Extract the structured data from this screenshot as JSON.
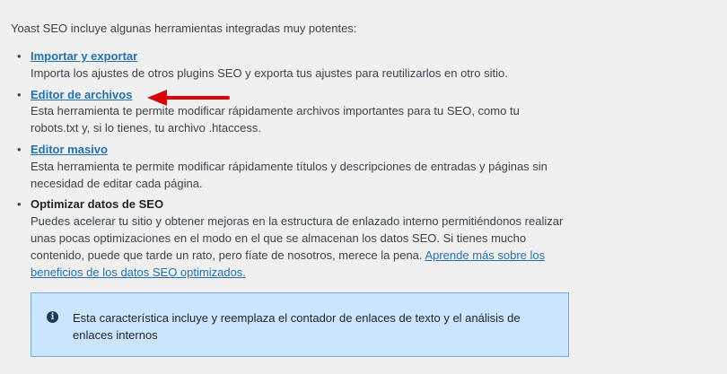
{
  "intro": "Yoast SEO incluye algunas herramientas integradas muy potentes:",
  "tools": [
    {
      "title": "Importar y exportar",
      "description": "Importa los ajustes de otros plugins SEO y exporta tus ajustes para reutilizarlos en otro sitio."
    },
    {
      "title": "Editor de archivos",
      "description": "Esta herramienta te permite modificar rápidamente archivos importantes para tu SEO, como tu robots.txt y, si lo tienes, tu archivo .htaccess."
    },
    {
      "title": "Editor masivo",
      "description": "Esta herramienta te permite modificar rápidamente títulos y descripciones de entradas y páginas sin necesidad de editar cada página."
    },
    {
      "title": "Optimizar datos de SEO",
      "description": "Puedes acelerar tu sitio y obtener mejoras en la estructura de enlazado interno permitiéndonos realizar unas pocas optimizaciones en el modo en el que se almacenan los datos SEO. Si tienes mucho contenido, puede que tarde un rato, pero fíate de nosotros, merece la pena.",
      "link_text": "Aprende más sobre los beneficios de los datos SEO optimizados."
    }
  ],
  "notice": {
    "icon": "info-icon",
    "text": "Esta característica incluye y reemplaza el contador de enlaces de texto y el análisis de enlaces internos"
  },
  "colors": {
    "link": "#2271b1",
    "notice_bg": "#cce5ff",
    "notice_border": "#72aee6",
    "arrow": "#e00000"
  }
}
